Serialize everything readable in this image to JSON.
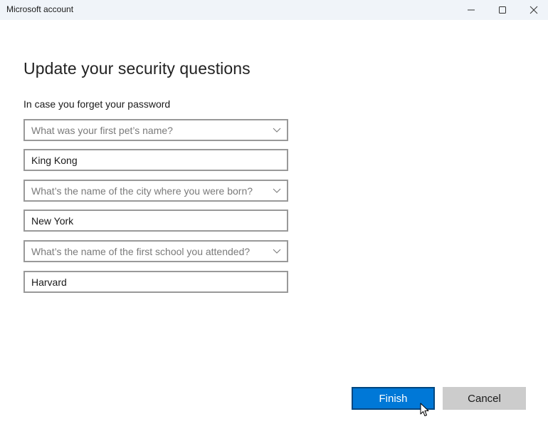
{
  "window": {
    "title": "Microsoft account",
    "controls": {
      "minimize_icon": "minimize-icon",
      "maximize_icon": "maximize-icon",
      "close_icon": "close-icon"
    }
  },
  "page": {
    "heading": "Update your security questions",
    "subheading": "In case you forget your password"
  },
  "questions": [
    {
      "question_placeholder": "What was your first pet’s name?",
      "answer": "King Kong"
    },
    {
      "question_placeholder": "What’s the name of the city where you were born?",
      "answer": "New York"
    },
    {
      "question_placeholder": "What’s the name of the first school you attended?",
      "answer": "Harvard"
    }
  ],
  "actions": {
    "finish_label": "Finish",
    "cancel_label": "Cancel"
  },
  "colors": {
    "accent": "#0078d7",
    "accent_border": "#00467f",
    "secondary_button": "#cccccc",
    "field_border": "#999999",
    "titlebar": "#f0f4f9"
  }
}
